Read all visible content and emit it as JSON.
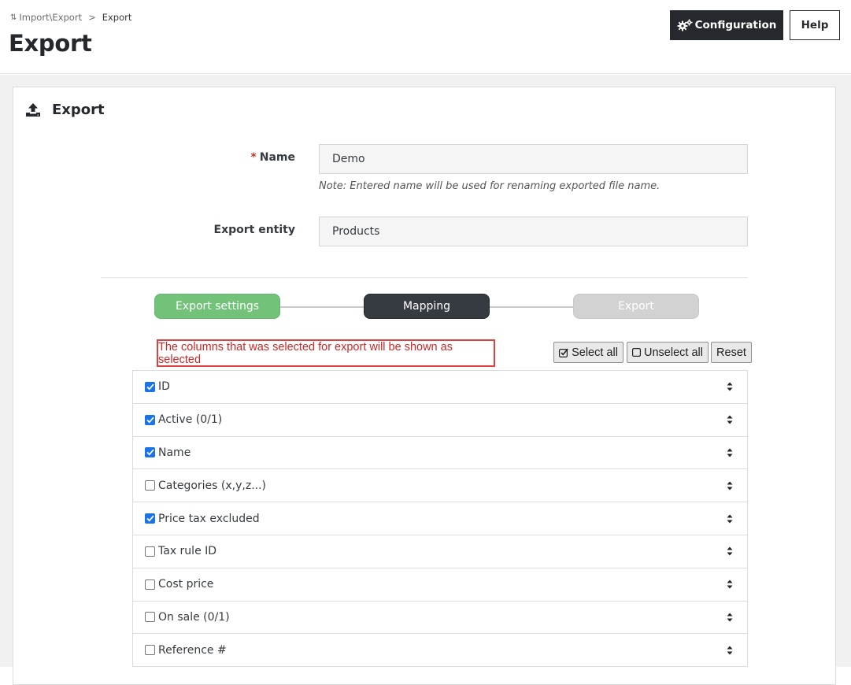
{
  "breadcrumb": {
    "parent": "Import\\Export",
    "separator": ">",
    "current": "Export"
  },
  "page": {
    "title": "Export"
  },
  "header_buttons": {
    "configuration": "Configuration",
    "help": "Help"
  },
  "card": {
    "title": "Export",
    "icon": "upload-icon"
  },
  "form": {
    "name": {
      "required_mark": "*",
      "label": "Name",
      "value": "Demo",
      "note": "Note: Entered name will be used for renaming exported file name."
    },
    "entity": {
      "label": "Export entity",
      "value": "Products"
    }
  },
  "steps": [
    {
      "label": "Export settings",
      "state": "done"
    },
    {
      "label": "Mapping",
      "state": "active"
    },
    {
      "label": "Export",
      "state": "todo"
    }
  ],
  "alert": "The columns that was selected for export will be shown as selected",
  "toolbar": {
    "select_all": "Select all",
    "unselect_all": "Unselect all",
    "reset": "Reset"
  },
  "columns": [
    {
      "label": "ID",
      "checked": true
    },
    {
      "label": "Active (0/1)",
      "checked": true
    },
    {
      "label": "Name",
      "checked": true
    },
    {
      "label": "Categories (x,y,z...)",
      "checked": false
    },
    {
      "label": "Price tax excluded",
      "checked": true
    },
    {
      "label": "Tax rule ID",
      "checked": false
    },
    {
      "label": "Cost price",
      "checked": false
    },
    {
      "label": "On sale (0/1)",
      "checked": false
    },
    {
      "label": "Reference #",
      "checked": false
    }
  ],
  "colors": {
    "accent_dark": "#25282c",
    "step_done": "#72c279",
    "step_active": "#363a41",
    "step_todo": "#d2d2d2",
    "alert_red": "#e0403f",
    "checkbox_blue": "#1a73e8"
  }
}
